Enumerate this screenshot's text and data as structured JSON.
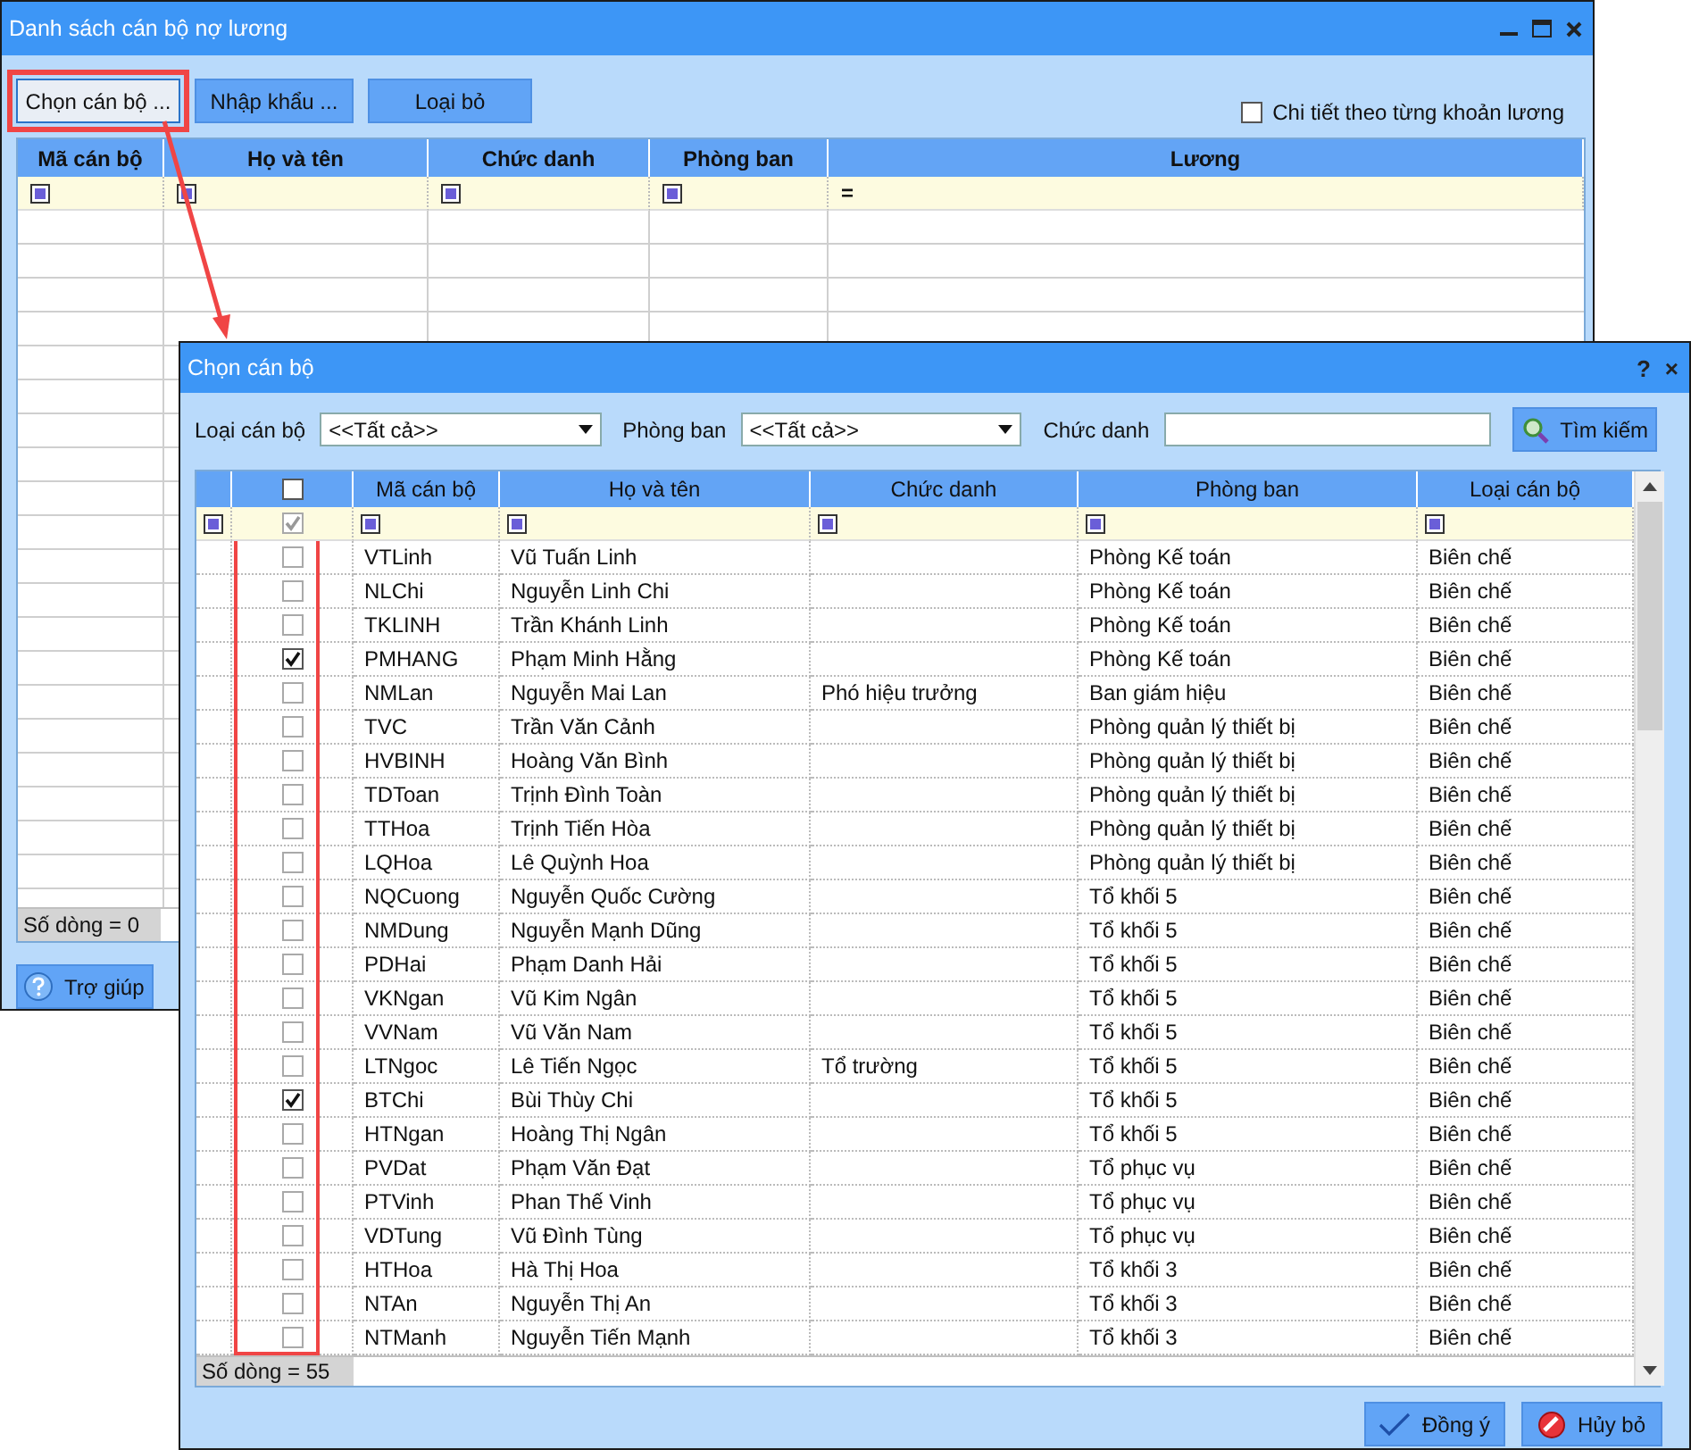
{
  "main_window": {
    "title": "Danh sách cán bộ nợ lương",
    "toolbar": [
      {
        "label": "Chọn cán bộ ...",
        "highlighted": true
      },
      {
        "label": "Nhập khẩu ...",
        "highlighted": false
      },
      {
        "label": "Loại bỏ",
        "highlighted": false
      }
    ],
    "detail_checkbox": {
      "label": "Chi tiết theo từng khoản lương",
      "checked": false
    },
    "grid": {
      "columns": [
        "Mã cán bộ",
        "Họ và tên",
        "Chức danh",
        "Phòng ban",
        "Lương"
      ],
      "filter_row": [
        {
          "kind": "square"
        },
        {
          "kind": "square"
        },
        {
          "kind": "square"
        },
        {
          "kind": "square"
        },
        {
          "kind": "equals",
          "symbol": "="
        }
      ],
      "status": "Số dòng = 0"
    },
    "help_button": "Trợ giúp"
  },
  "dialog": {
    "title": "Chọn cán bộ",
    "title_buttons": [
      "?",
      "×"
    ],
    "filters": [
      {
        "kind": "combo",
        "label": "Loại cán bộ",
        "value": "<<Tất cả>>"
      },
      {
        "kind": "combo",
        "label": "Phòng ban",
        "value": "<<Tất cả>>"
      },
      {
        "kind": "text",
        "label": "Chức danh"
      }
    ],
    "search_button": "Tìm kiếm",
    "grid": {
      "header_checkbox": {
        "checked": false
      },
      "filter_checkbox": {
        "checked": true
      },
      "highlight_check_column": true,
      "columns": [
        "Mã cán bộ",
        "Họ và tên",
        "Chức danh",
        "Phòng ban",
        "Loại cán bộ"
      ],
      "rows": [
        {
          "checked": false,
          "code": "VTLinh",
          "name": "Vũ Tuấn Linh",
          "title": "",
          "dept": "Phòng Kế toán",
          "type": "Biên chế"
        },
        {
          "checked": false,
          "code": "NLChi",
          "name": "Nguyễn Linh Chi",
          "title": "",
          "dept": "Phòng Kế toán",
          "type": "Biên chế"
        },
        {
          "checked": false,
          "code": "TKLINH",
          "name": "Trần Khánh Linh",
          "title": "",
          "dept": "Phòng Kế toán",
          "type": "Biên chế"
        },
        {
          "checked": true,
          "code": "PMHANG",
          "name": "Phạm Minh Hằng",
          "title": "",
          "dept": "Phòng Kế toán",
          "type": "Biên chế"
        },
        {
          "checked": false,
          "code": "NMLan",
          "name": "Nguyễn Mai Lan",
          "title": "Phó hiệu trưởng",
          "dept": "Ban giám hiệu",
          "type": "Biên chế"
        },
        {
          "checked": false,
          "code": "TVC",
          "name": "Trần Văn Cảnh",
          "title": "",
          "dept": "Phòng quản lý thiết bị",
          "type": "Biên chế"
        },
        {
          "checked": false,
          "code": "HVBINH",
          "name": "Hoàng Văn Bình",
          "title": "",
          "dept": "Phòng quản lý thiết bị",
          "type": "Biên chế"
        },
        {
          "checked": false,
          "code": "TDToan",
          "name": "Trịnh Đình Toàn",
          "title": "",
          "dept": "Phòng quản lý thiết bị",
          "type": "Biên chế"
        },
        {
          "checked": false,
          "code": "TTHoa",
          "name": "Trịnh Tiến Hòa",
          "title": "",
          "dept": "Phòng quản lý thiết bị",
          "type": "Biên chế"
        },
        {
          "checked": false,
          "code": "LQHoa",
          "name": "Lê Quỳnh Hoa",
          "title": "",
          "dept": "Phòng quản lý thiết bị",
          "type": "Biên chế"
        },
        {
          "checked": false,
          "code": "NQCuong",
          "name": "Nguyễn Quốc Cường",
          "title": "",
          "dept": "Tổ khối 5",
          "type": "Biên chế"
        },
        {
          "checked": false,
          "code": "NMDung",
          "name": "Nguyễn Mạnh Dũng",
          "title": "",
          "dept": "Tổ khối 5",
          "type": "Biên chế"
        },
        {
          "checked": false,
          "code": "PDHai",
          "name": "Phạm Danh Hải",
          "title": "",
          "dept": "Tổ khối 5",
          "type": "Biên chế"
        },
        {
          "checked": false,
          "code": "VKNgan",
          "name": "Vũ Kim Ngân",
          "title": "",
          "dept": "Tổ khối 5",
          "type": "Biên chế"
        },
        {
          "checked": false,
          "code": "VVNam",
          "name": "Vũ Văn Nam",
          "title": "",
          "dept": "Tổ khối 5",
          "type": "Biên chế"
        },
        {
          "checked": false,
          "code": "LTNgoc",
          "name": "Lê Tiến Ngọc",
          "title": "Tổ trường",
          "dept": "Tổ khối 5",
          "type": "Biên chế"
        },
        {
          "checked": true,
          "code": "BTChi",
          "name": "Bùi Thùy Chi",
          "title": "",
          "dept": "Tổ khối 5",
          "type": "Biên chế"
        },
        {
          "checked": false,
          "code": "HTNgan",
          "name": "Hoàng Thị Ngân",
          "title": "",
          "dept": "Tổ khối 5",
          "type": "Biên chế"
        },
        {
          "checked": false,
          "code": "PVDat",
          "name": "Phạm Văn Đạt",
          "title": "",
          "dept": "Tổ phục vụ",
          "type": "Biên chế"
        },
        {
          "checked": false,
          "code": "PTVinh",
          "name": "Phan Thế Vinh",
          "title": "",
          "dept": "Tổ phục vụ",
          "type": "Biên chế"
        },
        {
          "checked": false,
          "code": "VDTung",
          "name": "Vũ Đình Tùng",
          "title": "",
          "dept": "Tổ phục vụ",
          "type": "Biên chế"
        },
        {
          "checked": false,
          "code": "HTHoa",
          "name": "Hà Thị Hoa",
          "title": "",
          "dept": "Tổ khối 3",
          "type": "Biên chế"
        },
        {
          "checked": false,
          "code": "NTAn",
          "name": "Nguyễn Thị An",
          "title": "",
          "dept": "Tổ khối 3",
          "type": "Biên chế"
        },
        {
          "checked": false,
          "code": "NTManh",
          "name": "Nguyễn Tiến Mạnh",
          "title": "",
          "dept": "Tổ khối 3",
          "type": "Biên chế"
        }
      ],
      "status": "Số dòng = 55"
    },
    "buttons": [
      {
        "kind": "ok",
        "label": "Đồng ý"
      },
      {
        "kind": "cancel",
        "label": "Hủy bỏ"
      }
    ]
  }
}
